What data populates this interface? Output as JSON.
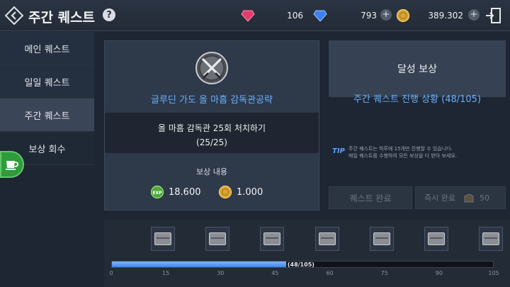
{
  "header": {
    "title": "주간 퀘스트",
    "help": "?",
    "currencies": [
      {
        "icon": "red-gem-icon",
        "value": "106"
      },
      {
        "icon": "blue-gem-icon",
        "value": "793"
      },
      {
        "icon": "gold-coin-icon",
        "value": "389.302"
      }
    ],
    "plus": "+"
  },
  "sidebar": {
    "items": [
      {
        "label": "메인 퀘스트"
      },
      {
        "label": "일일 퀘스트"
      },
      {
        "label": "주간 퀘스트"
      },
      {
        "label": "보상 회수"
      }
    ],
    "active_index": 2
  },
  "quest": {
    "title": "글루딘 가도 올 마흠 감독관공략",
    "task_line1": "올 마흠 감독관 25회 처치하기",
    "task_line2": "(25/25)",
    "reward_label": "보상 내용",
    "rewards": [
      {
        "icon": "exp-icon",
        "value": "18.600"
      },
      {
        "icon": "gold-coin-icon",
        "value": "1.000"
      }
    ]
  },
  "right": {
    "title": "달성 보상",
    "progress": "주간 퀘스트 진행 상황 (48/105)",
    "tip_label": "TIP",
    "tip_line1": "주간 퀘스트는 하루에 15개만 진행할 수 있습니다.",
    "tip_line2": "매일 퀘스트를 수행하여 모든 보상을 다 받아 보세요.",
    "complete_button": "퀘스트 완료",
    "instant_button": "즉시 완료",
    "instant_count": "50"
  },
  "progress_track": {
    "current": 48,
    "max": 105,
    "label": "(48/105)",
    "ticks": [
      "0",
      "15",
      "30",
      "45",
      "60",
      "75",
      "90",
      "105"
    ],
    "milestones": 7
  },
  "colors": {
    "accent_blue": "#6ab0ff",
    "panel_bg": "#2e394a",
    "sidebar_active": "#3a4557"
  }
}
